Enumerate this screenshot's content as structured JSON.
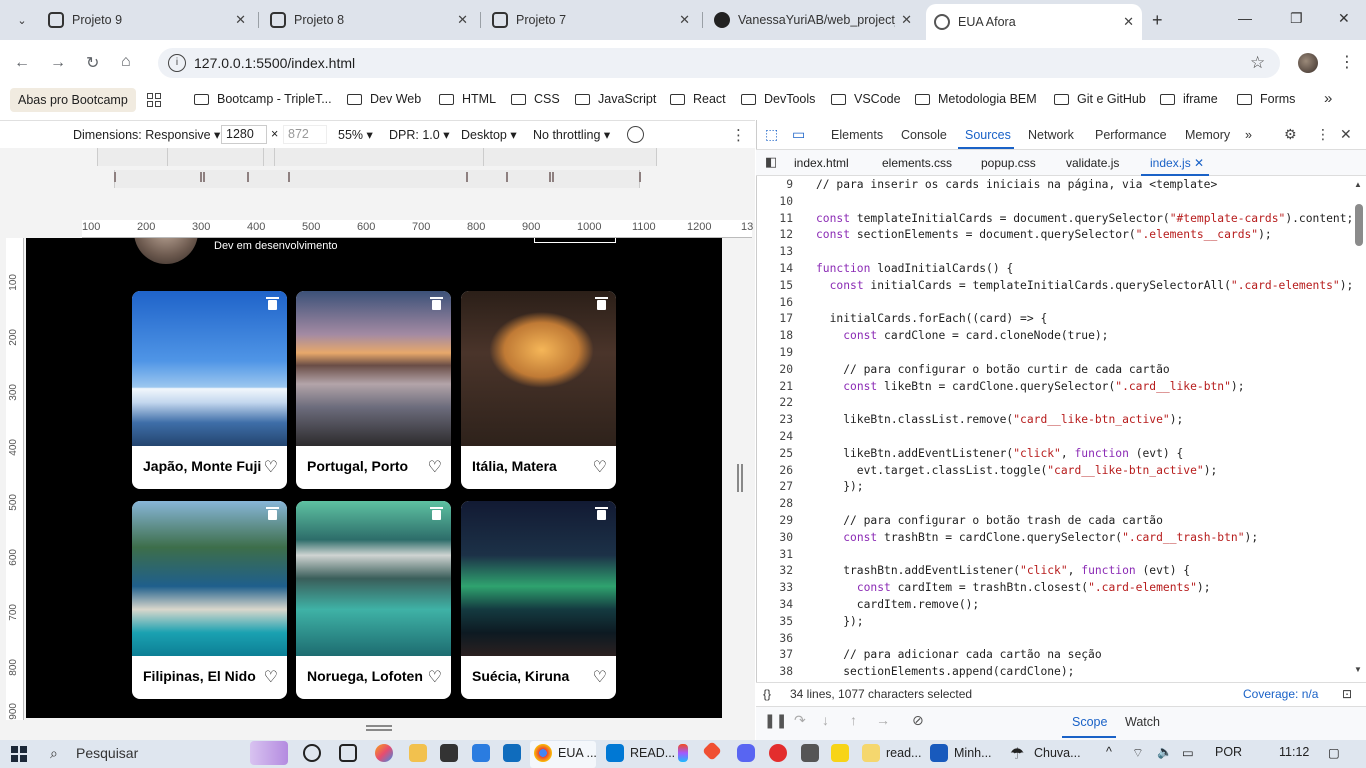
{
  "browser": {
    "tabs": [
      {
        "label": "Projeto 9",
        "icon": "page-icon"
      },
      {
        "label": "Projeto 8",
        "icon": "page-icon"
      },
      {
        "label": "Projeto 7",
        "icon": "page-icon"
      },
      {
        "label": "VanessaYuriAB/web_project_",
        "icon": "github-icon"
      },
      {
        "label": "EUA Afora",
        "icon": "globe-icon",
        "active": true
      }
    ],
    "new_tab": "+",
    "close_glyph": "✕",
    "url": "127.0.0.1:5500/index.html",
    "bookmarks": {
      "first": "Abas pro Bootcamp",
      "folders": [
        "Bootcamp - TripleT...",
        "Dev Web",
        "HTML",
        "CSS",
        "JavaScript",
        "React",
        "DevTools",
        "VSCode",
        "Metodologia BEM",
        "Git e GitHub",
        "iframe",
        "Forms"
      ],
      "more": "»"
    }
  },
  "device_toolbar": {
    "dimensions": "Dimensions: Responsive",
    "width": "1280",
    "times": "×",
    "height": "872",
    "zoom": "55%",
    "dpr": "DPR: 1.0",
    "mode": "Desktop",
    "throttle": "No throttling"
  },
  "ruler": {
    "horizontal": [
      "100",
      "200",
      "300",
      "400",
      "500",
      "600",
      "700",
      "800",
      "900",
      "1000",
      "1100",
      "1200",
      "13"
    ],
    "vertical": [
      "100",
      "200",
      "300",
      "400",
      "500",
      "600",
      "700",
      "800",
      "900"
    ]
  },
  "page": {
    "profile_description": "Dev em desenvolvimento",
    "cards": [
      {
        "title": "Japão, Monte Fuji"
      },
      {
        "title": "Portugal, Porto"
      },
      {
        "title": "Itália, Matera"
      },
      {
        "title": "Filipinas, El Nido"
      },
      {
        "title": "Noruega, Lofoten"
      },
      {
        "title": "Suécia, Kiruna"
      }
    ]
  },
  "devtools": {
    "tabs": [
      "Elements",
      "Console",
      "Sources",
      "Network",
      "Performance",
      "Memory"
    ],
    "active_tab": "Sources",
    "more": "»",
    "files": [
      "index.html",
      "elements.css",
      "popup.css",
      "validate.js",
      "index.js"
    ],
    "active_file": "index.js",
    "code": [
      {
        "n": "9",
        "t": "// para inserir os cards iniciais na página, via <template>"
      },
      {
        "n": "10",
        "t": ""
      },
      {
        "n": "11",
        "t": "const templateInitialCards = document.querySelector(\"#template-cards\").content;"
      },
      {
        "n": "12",
        "t": "const sectionElements = document.querySelector(\".elements__cards\");"
      },
      {
        "n": "13",
        "t": ""
      },
      {
        "n": "14",
        "t": "function loadInitialCards() {"
      },
      {
        "n": "15",
        "t": "  const initialCards = templateInitialCards.querySelectorAll(\".card-elements\");"
      },
      {
        "n": "16",
        "t": ""
      },
      {
        "n": "17",
        "t": "  initialCards.forEach((card) => {"
      },
      {
        "n": "18",
        "t": "    const cardClone = card.cloneNode(true);"
      },
      {
        "n": "19",
        "t": ""
      },
      {
        "n": "20",
        "t": "    // para configurar o botão curtir de cada cartão"
      },
      {
        "n": "21",
        "t": "    const likeBtn = cardClone.querySelector(\".card__like-btn\");"
      },
      {
        "n": "22",
        "t": ""
      },
      {
        "n": "23",
        "t": "    likeBtn.classList.remove(\"card__like-btn_active\");"
      },
      {
        "n": "24",
        "t": ""
      },
      {
        "n": "25",
        "t": "    likeBtn.addEventListener(\"click\", function (evt) {"
      },
      {
        "n": "26",
        "t": "      evt.target.classList.toggle(\"card__like-btn_active\");"
      },
      {
        "n": "27",
        "t": "    });"
      },
      {
        "n": "28",
        "t": ""
      },
      {
        "n": "29",
        "t": "    // para configurar o botão trash de cada cartão"
      },
      {
        "n": "30",
        "t": "    const trashBtn = cardClone.querySelector(\".card__trash-btn\");"
      },
      {
        "n": "31",
        "t": ""
      },
      {
        "n": "32",
        "t": "    trashBtn.addEventListener(\"click\", function (evt) {"
      },
      {
        "n": "33",
        "t": "      const cardItem = trashBtn.closest(\".card-elements\");"
      },
      {
        "n": "34",
        "t": "      cardItem.remove();"
      },
      {
        "n": "35",
        "t": "    });"
      },
      {
        "n": "36",
        "t": ""
      },
      {
        "n": "37",
        "t": "    // para adicionar cada cartão na seção"
      },
      {
        "n": "38",
        "t": "    sectionElements.append(cardClone);"
      }
    ],
    "status": {
      "selection": "34 lines, 1077 characters selected",
      "coverage": "Coverage: n/a",
      "braces": "{}"
    },
    "bottom_tabs": [
      "Scope",
      "Watch"
    ],
    "active_bottom_tab": "Scope"
  },
  "taskbar": {
    "search": "Pesquisar",
    "apps": [
      {
        "label": "EUA ...",
        "icon": "chrome-icon"
      },
      {
        "label": "READ...",
        "icon": "vscode-icon"
      },
      {
        "label": "read...",
        "icon": "notepad-icon"
      },
      {
        "label": "Minh...",
        "icon": "word-icon"
      }
    ],
    "weather": "Chuva...",
    "lang": "POR",
    "time": "11:12"
  },
  "colors": {
    "accent": "#1a62c7",
    "page_bg": "#000000",
    "tabstrip": "#dee3eb"
  }
}
